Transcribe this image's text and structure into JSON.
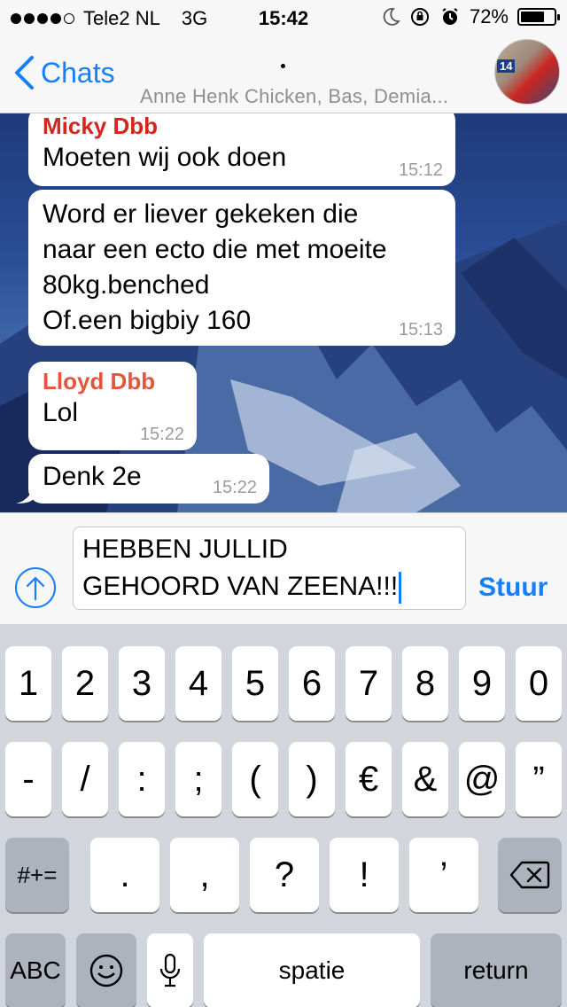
{
  "status_bar": {
    "carrier": "Tele2 NL",
    "network": "3G",
    "time": "15:42",
    "battery": "72%",
    "battery_level": 0.72,
    "icons": [
      "moon-icon",
      "rotation-lock-icon",
      "alarm-icon"
    ]
  },
  "nav": {
    "back_label": "Chats",
    "group_members": "Anne Henk Chicken, Bas, Demia..."
  },
  "messages": [
    {
      "sender": "Micky Dbb",
      "sender_color": "#d0281e",
      "text": "Moeten wij ook doen",
      "time": "15:12"
    },
    {
      "sender": "",
      "text": "Word er liever gekeken die\nnaar een ecto die met moeite\n80kg.benched\nOf.een bigbiy 160",
      "time": "15:13"
    },
    {
      "sender": "Lloyd Dbb",
      "sender_color": "#e4553d",
      "text": "Lol",
      "time": "15:22"
    },
    {
      "sender": "",
      "text": "Denk 2e",
      "time": "15:22"
    }
  ],
  "composer": {
    "text": "HEBBEN JULLID\nGEHOORD VAN ZEENA!!!",
    "send_label": "Stuur"
  },
  "keyboard": {
    "row1": [
      "1",
      "2",
      "3",
      "4",
      "5",
      "6",
      "7",
      "8",
      "9",
      "0"
    ],
    "row2": [
      "-",
      "/",
      ":",
      ";",
      "(",
      ")",
      "€",
      "&",
      "@",
      "”"
    ],
    "row3_mode": "#+=",
    "row3": [
      ".",
      ",",
      "?",
      "!",
      "’"
    ],
    "row4_abc": "ABC",
    "space": "spatie",
    "return": "return"
  },
  "colors": {
    "accent": "#157efb",
    "keyboard_bg": "#d2d5db"
  }
}
